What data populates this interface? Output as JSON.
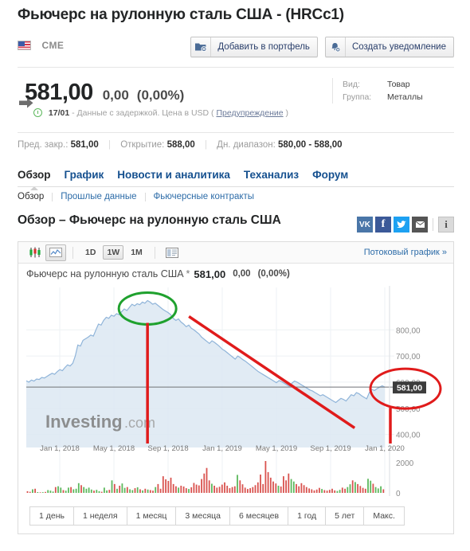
{
  "header": {
    "title": "Фьючерс на рулонную сталь США - (HRCc1)",
    "exchange": "CME",
    "flag_icon": "us-flag-icon",
    "add_portfolio_label": "Добавить в портфель",
    "create_alert_label": "Создать уведомление"
  },
  "quote": {
    "price": "581,00",
    "change": "0,00",
    "change_percent": "(0,00%)",
    "time": "17/01",
    "delay_text": "- Данные с задержкой. Цена в USD (",
    "disclaimer_link": "Предупреждение",
    "delay_text_end": ")"
  },
  "meta": {
    "kind_label": "Вид:",
    "kind_value": "Товар",
    "group_label": "Группа:",
    "group_value": "Металлы"
  },
  "stats": {
    "prev_close_label": "Пред. закр.:",
    "prev_close_value": "581,00",
    "open_label": "Открытие:",
    "open_value": "588,00",
    "range_label": "Дн. диапазон:",
    "range_value": "580,00 - 588,00"
  },
  "tabs": [
    {
      "label": "Обзор",
      "active": true
    },
    {
      "label": "График",
      "active": false
    },
    {
      "label": "Новости и аналитика",
      "active": false
    },
    {
      "label": "Теханализ",
      "active": false
    },
    {
      "label": "Форум",
      "active": false
    }
  ],
  "subnav": [
    {
      "label": "Обзор",
      "current": true
    },
    {
      "label": "Прошлые данные",
      "current": false
    },
    {
      "label": "Фьючерсные контракты",
      "current": false
    }
  ],
  "section": {
    "heading": "Обзор – Фьючерс на рулонную сталь США",
    "social": [
      {
        "name": "vk-icon",
        "glyph": "VK"
      },
      {
        "name": "facebook-icon",
        "glyph": "f"
      },
      {
        "name": "twitter-icon",
        "glyph": "🐦"
      },
      {
        "name": "email-icon",
        "glyph": "✉"
      },
      {
        "name": "info-icon",
        "glyph": "i"
      }
    ]
  },
  "chart_toolbar": {
    "candlestick_icon": "candlestick-chart-icon",
    "line_icon": "line-chart-icon",
    "intervals": [
      {
        "label": "1D",
        "selected": false
      },
      {
        "label": "1W",
        "selected": true
      },
      {
        "label": "1M",
        "selected": false
      }
    ],
    "table_icon": "table-view-icon",
    "stream_link": "Потоковый график »"
  },
  "chart_title": {
    "name": "Фьючерс на рулонную сталь США",
    "star": "*",
    "price": "581,00",
    "change": "0,00",
    "change_percent": "(0,00%)"
  },
  "chart_data": {
    "type": "area",
    "title": "Фьючерс на рулонную сталь США",
    "xlabel": "",
    "ylabel": "",
    "ylim": [
      350,
      950
    ],
    "yticks": [
      "800,00",
      "700,00",
      "600,00",
      "500,00",
      "400,00"
    ],
    "ytick_values": [
      800,
      700,
      600,
      500,
      400
    ],
    "xticks": [
      "Jan 1, 2018",
      "May 1, 2018",
      "Sep 1, 2018",
      "Jan 1, 2019",
      "May 1, 2019",
      "Sep 1, 2019",
      "Jan 1, 2020"
    ],
    "grid": true,
    "legend": false,
    "current_price_label": "581,00",
    "volume_axis": {
      "ticks": [
        "2000",
        "0"
      ],
      "values": [
        2000,
        0
      ]
    },
    "watermark": "Investing.com",
    "line_color": "#8fb4d9",
    "fill_color": "#dce8f2",
    "annotation_colors": {
      "peak_ellipse": "#1fa12e",
      "price_ellipse": "#e01b1b",
      "marker_line": "#e01b1b"
    },
    "series": [
      {
        "name": "HRCc1",
        "values": [
          605,
          600,
          608,
          604,
          612,
          610,
          618,
          616,
          622,
          628,
          634,
          630,
          640,
          648,
          644,
          656,
          666,
          662,
          672,
          700,
          742,
          738,
          760,
          766,
          772,
          780,
          776,
          800,
          822,
          818,
          836,
          848,
          844,
          856,
          852,
          862,
          858,
          870,
          880,
          874,
          886,
          898,
          892,
          900,
          896,
          906,
          902,
          912,
          906,
          898,
          902,
          894,
          886,
          878,
          872,
          866,
          858,
          844,
          836,
          842,
          830,
          822,
          812,
          818,
          806,
          800,
          792,
          784,
          772,
          764,
          756,
          748,
          758,
          752,
          744,
          736,
          726,
          720,
          712,
          704,
          696,
          688,
          700,
          694,
          686,
          680,
          672,
          664,
          656,
          648,
          640,
          634,
          628,
          622,
          616,
          610,
          604,
          598,
          606,
          602,
          596,
          590,
          584,
          596,
          604,
          600,
          594,
          588,
          582,
          576,
          570,
          566,
          560,
          554,
          548,
          552,
          546,
          540,
          534,
          528,
          522,
          530,
          538,
          534,
          528,
          540,
          552,
          548,
          560,
          556,
          548,
          542,
          536,
          560,
          572,
          568,
          575,
          581,
          586,
          581
        ]
      }
    ],
    "volume": {
      "name": "Volume",
      "values": [
        120,
        80,
        260,
        300,
        60,
        40,
        50,
        70,
        200,
        160,
        100,
        420,
        480,
        380,
        200,
        160,
        380,
        420,
        260,
        300,
        700,
        560,
        420,
        300,
        380,
        240,
        160,
        220,
        120,
        80,
        380,
        180,
        220,
        900,
        640,
        300,
        520,
        680,
        360,
        420,
        260,
        200,
        340,
        400,
        260,
        180,
        300,
        240,
        200,
        160,
        420,
        640,
        300,
        1200,
        980,
        860,
        1100,
        640,
        480,
        380,
        520,
        460,
        340,
        280,
        400,
        720,
        600,
        540,
        1000,
        1400,
        1800,
        900,
        660,
        520,
        380,
        440,
        600,
        760,
        520,
        340,
        420,
        480,
        1300,
        900,
        620,
        380,
        280,
        340,
        420,
        560,
        760,
        1320,
        640,
        2300,
        1500,
        1100,
        820,
        680,
        520,
        460,
        1200,
        900,
        1400,
        1000,
        820,
        640,
        480,
        700,
        560,
        420,
        320,
        260,
        180,
        240,
        360,
        280,
        200,
        160,
        220,
        300,
        180,
        140,
        220,
        380,
        300,
        420,
        620,
        900,
        780,
        640,
        500,
        360,
        300,
        1020,
        880,
        660,
        420,
        320,
        480,
        260
      ],
      "colors": [
        "red",
        "green"
      ]
    }
  },
  "range_buttons": [
    {
      "label": "1 день"
    },
    {
      "label": "1 неделя"
    },
    {
      "label": "1 месяц"
    },
    {
      "label": "3 месяца"
    },
    {
      "label": "6 месяцев"
    },
    {
      "label": "1 год"
    },
    {
      "label": "5 лет"
    },
    {
      "label": "Макс."
    }
  ]
}
